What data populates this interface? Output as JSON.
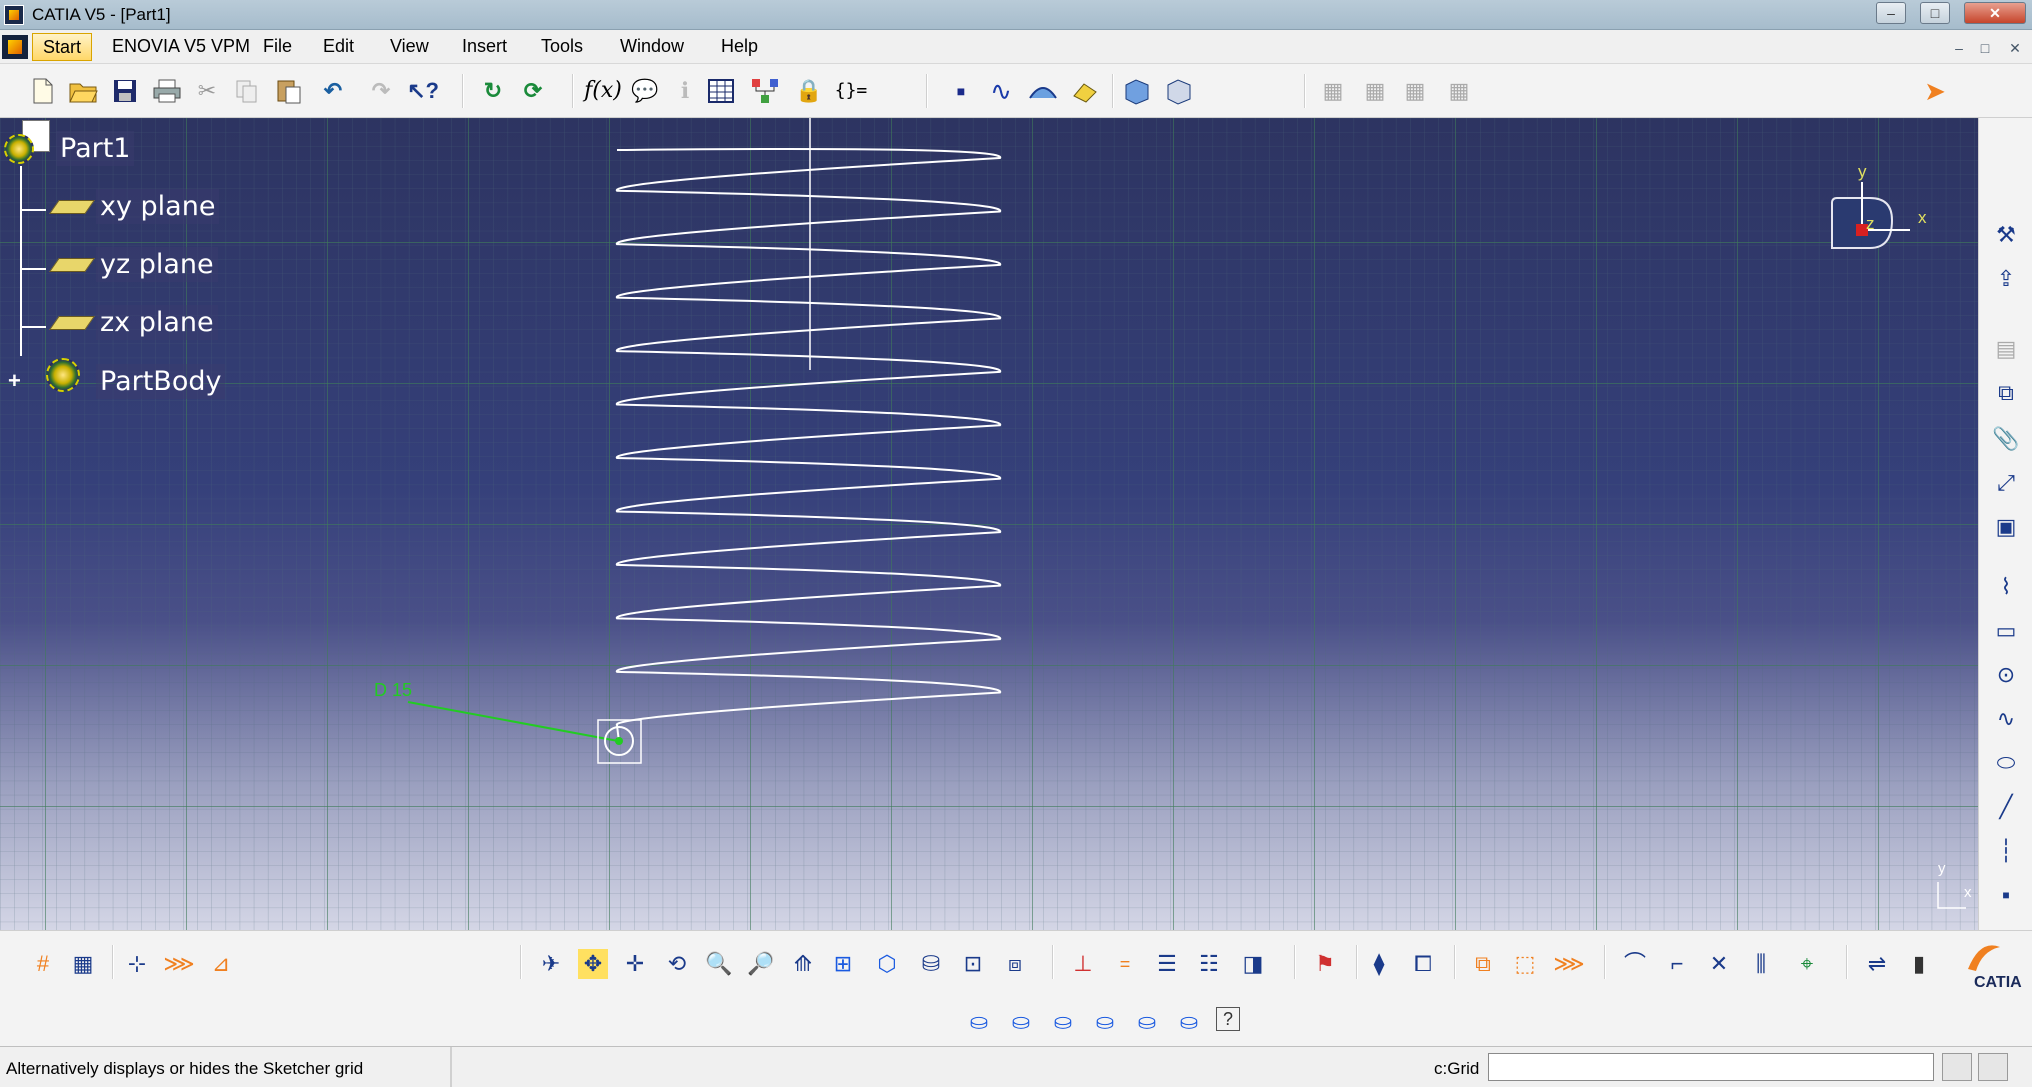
{
  "window": {
    "title": "CATIA V5 - [Part1]",
    "minimize": "–",
    "maximize": "□",
    "close": "✕"
  },
  "menu": {
    "items": [
      "Start",
      "ENOVIA V5 VPM",
      "File",
      "Edit",
      "View",
      "Insert",
      "Tools",
      "Window",
      "Help"
    ],
    "mdi": [
      "–",
      "□",
      "✕"
    ]
  },
  "tree": {
    "root": "Part1",
    "nodes": [
      "xy plane",
      "yz plane",
      "zx plane",
      "PartBody"
    ]
  },
  "viewport": {
    "dimension_label": "D 15",
    "compass_axes": [
      "y",
      "z",
      "x"
    ],
    "corner_axes": [
      "y",
      "x"
    ],
    "helix_turns": 11,
    "colors": {
      "background_top": "#2d3461",
      "background_bottom": "#d4d6e6",
      "grid": "#5a8a72",
      "dimension": "#22cc22",
      "profile": "#ffffff"
    }
  },
  "toolbars": {
    "top": [
      "new-icon",
      "open-icon",
      "save-icon",
      "print-icon",
      "cut-icon",
      "copy-icon",
      "paste-icon",
      "undo-icon",
      "redo-icon",
      "whats-this-icon",
      "update-icon",
      "update-all-icon",
      "formula-icon",
      "knowledge-icon",
      "info-icon",
      "table-icon",
      "tree-icon",
      "lock-icon",
      "braces-icon",
      "point-icon",
      "spline-icon",
      "surface-icon",
      "sketch-icon",
      "part-design-icon",
      "shape-icon",
      "measure-a-icon",
      "measure-b-icon",
      "measure-c-icon",
      "measure-d-icon",
      "select-icon"
    ],
    "right_label_hint": "sketcher tools",
    "bottom_row1": [
      "grid-icon",
      "snap-grid-icon",
      "construction-icon",
      "geometry-icon",
      "dimension-icon",
      "fly-icon",
      "fit-all-icon",
      "pan-icon",
      "rotate-icon",
      "zoom-in-icon",
      "zoom-out-icon",
      "normal-view-icon",
      "multi-view-icon",
      "iso-view-icon",
      "shading-icon",
      "edges-icon",
      "hide-icon",
      "constraint-icon",
      "equal-icon",
      "tree-expand-icon",
      "tree-collapse-icon",
      "analysis-icon",
      "measure-icon",
      "workbench-icon",
      "pad-icon",
      "pocket-icon",
      "fillet-icon",
      "chamfer-icon",
      "draft-icon",
      "arc-icon",
      "corner-icon",
      "trim-icon",
      "mirror-icon",
      "project-icon",
      "exit-icon",
      "ruler-icon",
      "catia-logo-icon"
    ],
    "bottom_row2": [
      "cyl1-icon",
      "cyl2-icon",
      "cyl3-icon",
      "cyl4-icon",
      "cyl5-icon",
      "cyl6-icon",
      "help-icon"
    ]
  },
  "status": {
    "message": "Alternatively displays or hides the Sketcher grid",
    "command_label": "c:Grid",
    "command_value": ""
  }
}
